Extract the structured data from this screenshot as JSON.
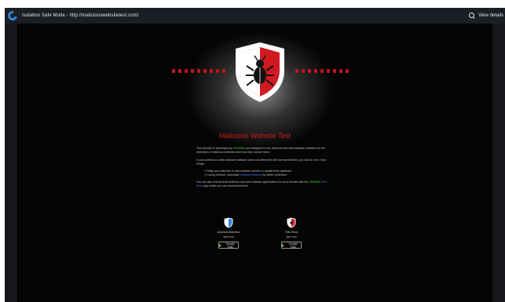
{
  "window": {
    "title": "Isolation Safe Mode - http://maliciouswebsitetest.com/",
    "view_details": "View details",
    "icon": "app-logo-icon"
  },
  "page": {
    "heading": "Malicious Website Test",
    "para1_a": "This website is developed by ",
    "para1_brand": "ZEMANA",
    "para1_b": " and designed to test antivirus and anti-malware software for the detection of malicious websites and how they handle them.",
    "para2": "If your antivirus or anti-malware software does not detect this site as harmful then you can do one of two things:",
    "bullet1": "Notify your antivirus or anti-malware vendor to update their database",
    "bullet2_a": "If using Android, download ",
    "bullet2_link": "Zemana Antivirus",
    "bullet2_b": " for better protection",
    "para4_a": "You can also test Android antivirus and anti-malware applications for virus threats with the ",
    "para4_brand": "ZEMANA",
    "para4_link": "Test Virus",
    "para4_b": " app which you can download below."
  },
  "apps": [
    {
      "name": "Android Antivirus",
      "store_small": "GET IT ON",
      "store": "Google Play",
      "icon": "blue-shield-icon"
    },
    {
      "name": "Test Virus",
      "store_small": "GET IT ON",
      "store": "Google Play",
      "icon": "red-shield-icon"
    }
  ],
  "colors": {
    "accent_red": "#c4141c",
    "brand_green": "#29e04a",
    "link_blue": "#4a78ff",
    "titlebar": "#1b1e24"
  }
}
